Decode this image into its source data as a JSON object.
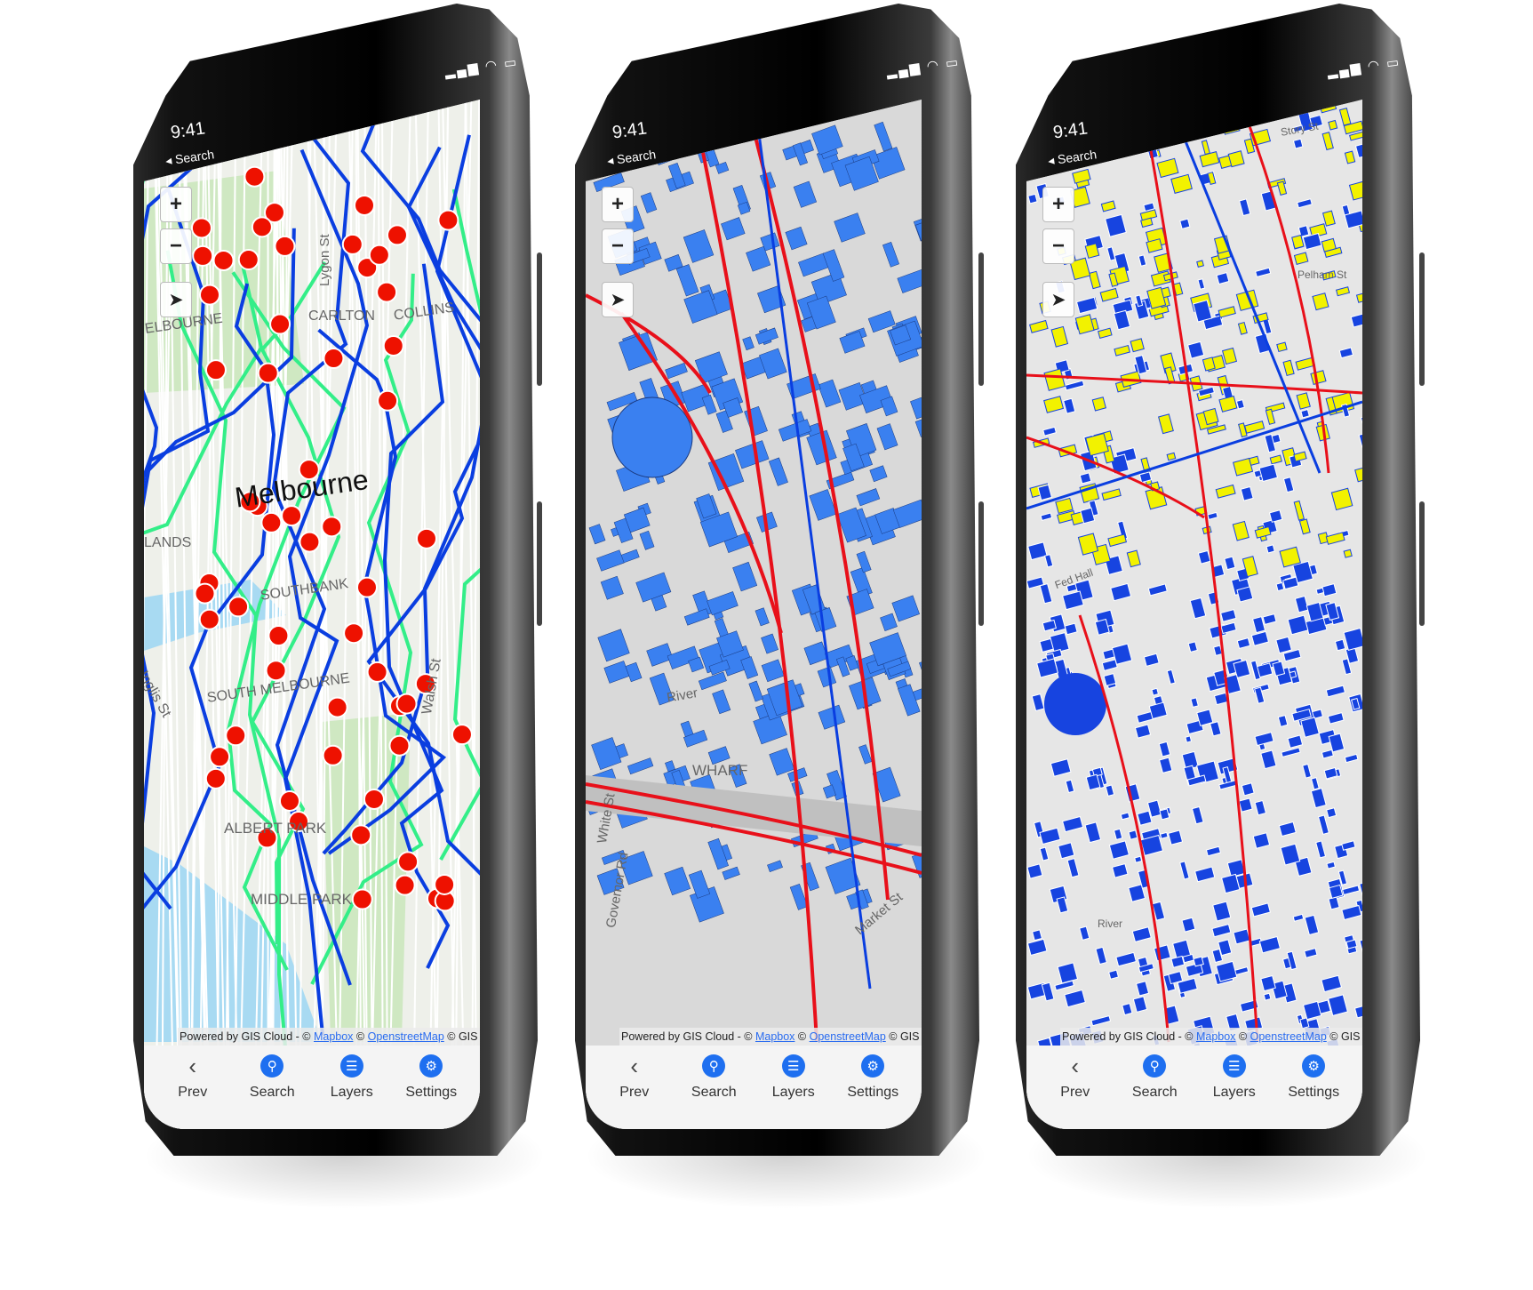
{
  "status": {
    "time": "9:41",
    "back_label": "Search",
    "signal_icons": "signal-wifi-battery"
  },
  "map_controls": {
    "zoom_in": "+",
    "zoom_out": "−",
    "locate_icon": "navigation-arrow-icon"
  },
  "attribution": {
    "prefix": "Powered by GIS Cloud - ©",
    "mapbox": "Mapbox",
    "sep": "©",
    "osm": "OpenstreetMap",
    "gis": "© GIS Cloud"
  },
  "nav": [
    {
      "label": "Prev",
      "icon": "chevron-left-icon"
    },
    {
      "label": "Search",
      "icon": "search-icon"
    },
    {
      "label": "Layers",
      "icon": "layers-icon"
    },
    {
      "label": "Settings",
      "icon": "gear-icon"
    }
  ],
  "phones": [
    {
      "theme": "transit",
      "labels": [
        "Melbourne",
        "Lygon St",
        "CARLTON",
        "COLLINS",
        "ELBOURNE",
        "LANDS",
        "SOUTHBANK",
        "SOUTH MELBOURNE",
        "Inglis St",
        "Walsh St",
        "ALBERT PARK",
        "MIDDLE PARK"
      ]
    },
    {
      "theme": "buildings",
      "labels": [
        "River",
        "White St",
        "Governor Rd",
        "Market St",
        "WHARF"
      ]
    },
    {
      "theme": "parcels",
      "labels": [
        "Story St",
        "Pelham St",
        "Fed Hall",
        "River"
      ]
    }
  ],
  "colors": {
    "accent": "#1e6ff0",
    "route_blue": "#0a3ee0",
    "route_green": "#33ee88",
    "point_red": "#ee1100",
    "building_blue": "#3a80f0",
    "parcel_yellow": "#f2f200",
    "line_red": "#e8101a"
  }
}
